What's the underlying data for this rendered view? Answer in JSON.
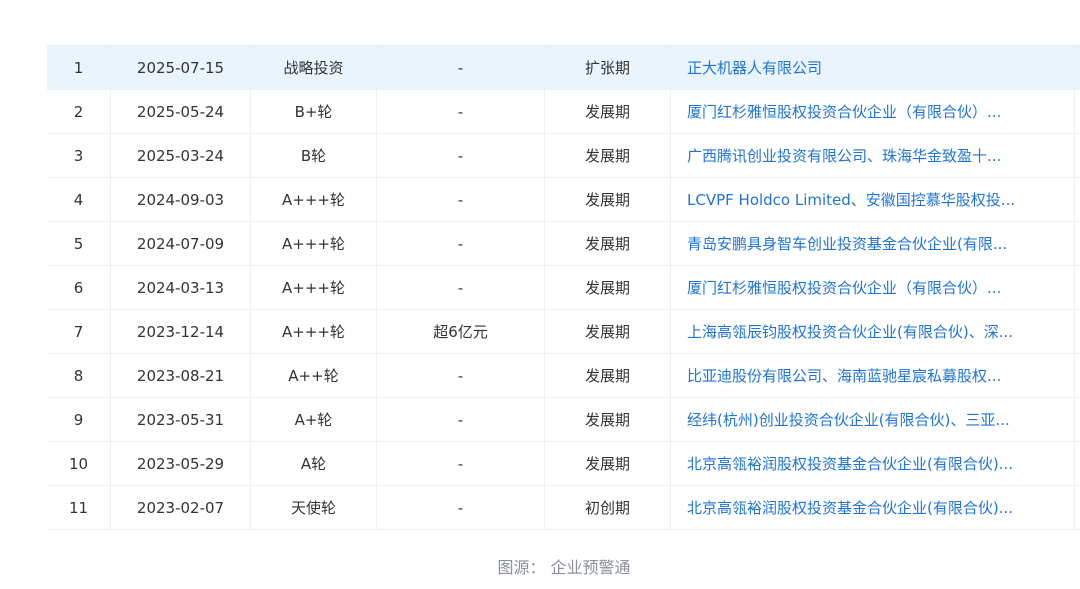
{
  "table": {
    "rows": [
      {
        "idx": "1",
        "date": "2025-07-15",
        "round": "战略投资",
        "amount": "-",
        "stage": "扩张期",
        "investors": "正大机器人有限公司"
      },
      {
        "idx": "2",
        "date": "2025-05-24",
        "round": "B+轮",
        "amount": "-",
        "stage": "发展期",
        "investors": "厦门红杉雅恒股权投资合伙企业（有限合伙）..."
      },
      {
        "idx": "3",
        "date": "2025-03-24",
        "round": "B轮",
        "amount": "-",
        "stage": "发展期",
        "investors": "广西腾讯创业投资有限公司、珠海华金致盈十..."
      },
      {
        "idx": "4",
        "date": "2024-09-03",
        "round": "A+++轮",
        "amount": "-",
        "stage": "发展期",
        "investors": "LCVPF Holdco Limited、安徽国控慕华股权投..."
      },
      {
        "idx": "5",
        "date": "2024-07-09",
        "round": "A+++轮",
        "amount": "-",
        "stage": "发展期",
        "investors": "青岛安鹏具身智车创业投资基金合伙企业(有限..."
      },
      {
        "idx": "6",
        "date": "2024-03-13",
        "round": "A+++轮",
        "amount": "-",
        "stage": "发展期",
        "investors": "厦门红杉雅恒股权投资合伙企业（有限合伙）..."
      },
      {
        "idx": "7",
        "date": "2023-12-14",
        "round": "A+++轮",
        "amount": "超6亿元",
        "stage": "发展期",
        "investors": "上海高瓴辰钧股权投资合伙企业(有限合伙)、深..."
      },
      {
        "idx": "8",
        "date": "2023-08-21",
        "round": "A++轮",
        "amount": "-",
        "stage": "发展期",
        "investors": "比亚迪股份有限公司、海南蓝驰星宸私募股权..."
      },
      {
        "idx": "9",
        "date": "2023-05-31",
        "round": "A+轮",
        "amount": "-",
        "stage": "发展期",
        "investors": "经纬(杭州)创业投资合伙企业(有限合伙)、三亚..."
      },
      {
        "idx": "10",
        "date": "2023-05-29",
        "round": "A轮",
        "amount": "-",
        "stage": "发展期",
        "investors": "北京高瓴裕润股权投资基金合伙企业(有限合伙)..."
      },
      {
        "idx": "11",
        "date": "2023-02-07",
        "round": "天使轮",
        "amount": "-",
        "stage": "初创期",
        "investors": "北京高瓴裕润股权投资基金合伙企业(有限合伙)..."
      }
    ],
    "highlight_color": "#eaf4fd",
    "link_color": "#1f74d6"
  },
  "caption": {
    "text": "图源：  企业预警通"
  }
}
